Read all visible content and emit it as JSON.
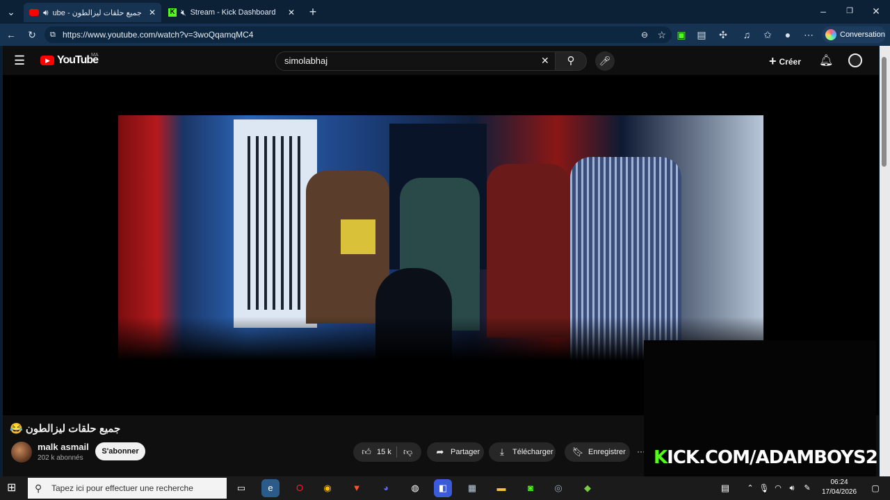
{
  "browser": {
    "tabs": [
      {
        "label": "جميع حلقات ليزالطون 😂 - YouTube",
        "short": "ube - جميع حلقات ليزالطون",
        "active": true
      },
      {
        "label": "Stream - Kick Dashboard",
        "active": false
      }
    ],
    "url": "https://www.youtube.com/watch?v=3woQqamqMC4",
    "conversation_label": "Conversation"
  },
  "youtube": {
    "logo_text": "YouTube",
    "region": "MA",
    "search_value": "simolabhaj",
    "create_label": "Créer",
    "video_title": "جميع حلقات ليزالطون 😂",
    "channel_name": "malk asmail",
    "subscribers": "202 k abonnés",
    "subscribe_label": "S'abonner",
    "likes": "15 k",
    "share_label": "Partager",
    "download_label": "Télécharger",
    "save_label": "Enregistrer",
    "more_label": "···"
  },
  "overlay": {
    "kick_text_k": "K",
    "kick_text_rest": "ICK.COM/ADAMBOYS2"
  },
  "taskbar": {
    "search_placeholder": "Tapez ici pour effectuer une recherche",
    "time": "06:24",
    "date": "17/04/2026"
  },
  "colors": {
    "kick_green": "#53fc18",
    "youtube_red": "#ff0000",
    "browser_chrome": "#163352"
  }
}
